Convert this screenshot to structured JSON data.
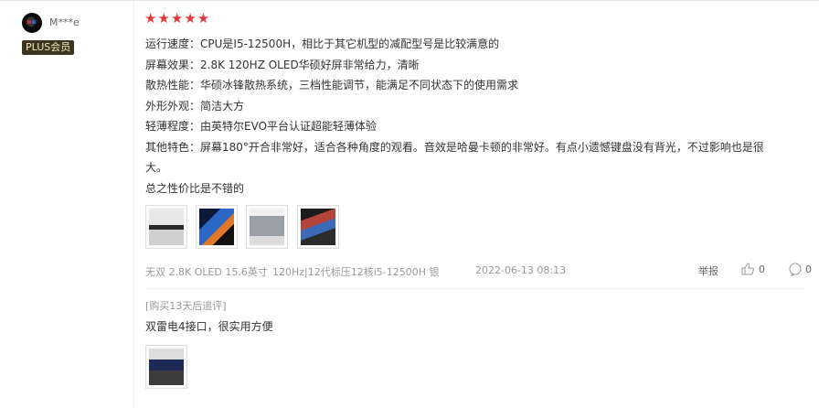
{
  "review": {
    "username": "M***e",
    "badge": "PLUS会员",
    "stars": "★★★★★",
    "rating": 5,
    "lines": [
      "运行速度：CPU是I5-12500H，相比于其它机型的减配型号是比较满意的",
      "屏幕效果：2.8K 120HZ OLED华硕好屏非常给力，清晰",
      "散热性能：华硕冰锋散热系统，三档性能调节，能满足不同状态下的使用需求",
      "外形外观：简洁大方",
      "轻薄程度：由英特尔EVO平台认证超能轻薄体验",
      "其他特色：屏幕180°开合非常好，适合各种角度的观看。音效是哈曼卡顿的非常好。有点小遗憾键盘没有背光，不过影响也是很",
      "大。",
      "总之性价比是不错的"
    ],
    "meta": {
      "variant": "无双 2.8K OLED 15.6英寸",
      "config": "120Hz|12代标压12核i5-12500H 银",
      "date": "2022-06-13 08:13"
    },
    "actions": {
      "report": "举报",
      "likes": "0",
      "comments": "0"
    },
    "followup": {
      "label": "[购买13天后追评]",
      "text": "双雷电4接口，很实用方便"
    }
  },
  "colors": {
    "stars": "#e4393c",
    "badge_bg": "#3b3420",
    "badge_text": "#f4e6b4"
  },
  "icons": [
    "thumbs-up-icon",
    "comment-icon"
  ]
}
